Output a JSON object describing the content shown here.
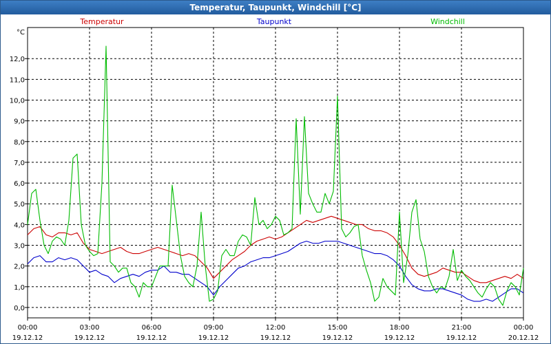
{
  "window": {
    "title": "Temperatur, Taupunkt, Windchill [°C]"
  },
  "chart_data": {
    "type": "line",
    "title": "Temperatur, Taupunkt, Windchill [°C]",
    "ylabel": "°C",
    "ylim": [
      -0.5,
      13.5
    ],
    "y_ticks": [
      0,
      1,
      2,
      3,
      4,
      5,
      6,
      7,
      8,
      9,
      10,
      11,
      12
    ],
    "y_tick_labels": [
      "0,0",
      "1,0",
      "2,0",
      "3,0",
      "4,0",
      "5,0",
      "6,0",
      "7,0",
      "8,0",
      "9,0",
      "10,0",
      "11,0",
      "12,0"
    ],
    "xlim": [
      0,
      24
    ],
    "x_ticks": [
      0,
      3,
      6,
      9,
      12,
      15,
      18,
      21,
      24
    ],
    "x_tick_labels": [
      [
        "00:00",
        "19.12.12"
      ],
      [
        "03:00",
        "19.12.12"
      ],
      [
        "06:00",
        "19.12.12"
      ],
      [
        "09:00",
        "19.12.12"
      ],
      [
        "12:00",
        "19.12.12"
      ],
      [
        "15:00",
        "19.12.12"
      ],
      [
        "18:00",
        "19.12.12"
      ],
      [
        "21:00",
        "19.12.12"
      ],
      [
        "00:00",
        "20.12.12"
      ]
    ],
    "grid": true,
    "legend_position": "top",
    "series": [
      {
        "name": "Temperatur",
        "color": "#cc0000",
        "x": [
          0,
          0.3,
          0.6,
          0.9,
          1.2,
          1.5,
          1.8,
          2.1,
          2.4,
          2.7,
          3.0,
          3.3,
          3.6,
          3.9,
          4.2,
          4.5,
          4.8,
          5.1,
          5.4,
          5.7,
          6.0,
          6.3,
          6.6,
          6.9,
          7.2,
          7.5,
          7.8,
          8.1,
          8.4,
          8.7,
          9.0,
          9.3,
          9.6,
          9.9,
          10.2,
          10.5,
          10.8,
          11.1,
          11.4,
          11.7,
          12.0,
          12.3,
          12.6,
          12.9,
          13.2,
          13.5,
          13.8,
          14.1,
          14.4,
          14.7,
          15.0,
          15.3,
          15.6,
          15.9,
          16.2,
          16.5,
          16.8,
          17.1,
          17.4,
          17.7,
          18.0,
          18.3,
          18.6,
          18.9,
          19.2,
          19.5,
          19.8,
          20.1,
          20.4,
          20.7,
          21.0,
          21.3,
          21.6,
          21.9,
          22.2,
          22.5,
          22.8,
          23.1,
          23.4,
          23.7,
          24.0
        ],
        "values": [
          3.5,
          3.8,
          3.9,
          3.5,
          3.4,
          3.6,
          3.6,
          3.5,
          3.6,
          3.1,
          2.8,
          2.7,
          2.6,
          2.7,
          2.8,
          2.9,
          2.7,
          2.6,
          2.6,
          2.7,
          2.8,
          2.9,
          2.8,
          2.7,
          2.6,
          2.5,
          2.6,
          2.5,
          2.2,
          1.9,
          1.4,
          1.7,
          2.0,
          2.3,
          2.5,
          2.7,
          3.0,
          3.2,
          3.3,
          3.4,
          3.3,
          3.4,
          3.6,
          3.8,
          4.0,
          4.2,
          4.1,
          4.2,
          4.3,
          4.4,
          4.3,
          4.2,
          4.1,
          4.0,
          4.0,
          3.8,
          3.7,
          3.7,
          3.6,
          3.4,
          3.0,
          2.5,
          1.9,
          1.6,
          1.5,
          1.6,
          1.7,
          1.9,
          1.8,
          1.7,
          1.7,
          1.5,
          1.3,
          1.2,
          1.2,
          1.3,
          1.4,
          1.5,
          1.4,
          1.6,
          1.4
        ]
      },
      {
        "name": "Taupunkt",
        "color": "#0000cc",
        "x": [
          0,
          0.3,
          0.6,
          0.9,
          1.2,
          1.5,
          1.8,
          2.1,
          2.4,
          2.7,
          3.0,
          3.3,
          3.6,
          3.9,
          4.2,
          4.5,
          4.8,
          5.1,
          5.4,
          5.7,
          6.0,
          6.3,
          6.6,
          6.9,
          7.2,
          7.5,
          7.8,
          8.1,
          8.4,
          8.7,
          9.0,
          9.3,
          9.6,
          9.9,
          10.2,
          10.5,
          10.8,
          11.1,
          11.4,
          11.7,
          12.0,
          12.3,
          12.6,
          12.9,
          13.2,
          13.5,
          13.8,
          14.1,
          14.4,
          14.7,
          15.0,
          15.3,
          15.6,
          15.9,
          16.2,
          16.5,
          16.8,
          17.1,
          17.4,
          17.7,
          18.0,
          18.3,
          18.6,
          18.9,
          19.2,
          19.5,
          19.8,
          20.1,
          20.4,
          20.7,
          21.0,
          21.3,
          21.6,
          21.9,
          22.2,
          22.5,
          22.8,
          23.1,
          23.4,
          23.7,
          24.0
        ],
        "values": [
          2.1,
          2.4,
          2.5,
          2.2,
          2.2,
          2.4,
          2.3,
          2.4,
          2.3,
          2.0,
          1.7,
          1.8,
          1.6,
          1.5,
          1.2,
          1.4,
          1.5,
          1.6,
          1.5,
          1.7,
          1.8,
          1.8,
          2.0,
          1.7,
          1.7,
          1.6,
          1.6,
          1.4,
          1.2,
          1.0,
          0.6,
          1.0,
          1.3,
          1.6,
          1.9,
          2.0,
          2.2,
          2.3,
          2.4,
          2.4,
          2.5,
          2.6,
          2.7,
          2.9,
          3.1,
          3.2,
          3.1,
          3.1,
          3.2,
          3.2,
          3.2,
          3.1,
          3.0,
          2.9,
          2.8,
          2.7,
          2.6,
          2.6,
          2.5,
          2.3,
          2.0,
          1.5,
          1.1,
          0.9,
          0.8,
          0.8,
          0.9,
          0.9,
          0.8,
          0.7,
          0.6,
          0.4,
          0.3,
          0.3,
          0.4,
          0.3,
          0.5,
          0.7,
          0.9,
          0.9,
          0.7
        ]
      },
      {
        "name": "Windchill",
        "color": "#00bb00",
        "x": [
          0,
          0.2,
          0.4,
          0.6,
          0.8,
          1.0,
          1.2,
          1.4,
          1.6,
          1.8,
          2.0,
          2.2,
          2.4,
          2.6,
          2.8,
          3.0,
          3.2,
          3.4,
          3.6,
          3.8,
          4.0,
          4.2,
          4.4,
          4.6,
          4.8,
          5.0,
          5.2,
          5.4,
          5.6,
          5.8,
          6.0,
          6.2,
          6.4,
          6.6,
          6.8,
          7.0,
          7.2,
          7.4,
          7.6,
          7.8,
          8.0,
          8.2,
          8.4,
          8.6,
          8.8,
          9.0,
          9.2,
          9.4,
          9.6,
          9.8,
          10.0,
          10.2,
          10.4,
          10.6,
          10.8,
          11.0,
          11.2,
          11.4,
          11.6,
          11.8,
          12.0,
          12.2,
          12.4,
          12.6,
          12.8,
          13.0,
          13.2,
          13.4,
          13.6,
          13.8,
          14.0,
          14.2,
          14.4,
          14.6,
          14.8,
          15.0,
          15.2,
          15.4,
          15.6,
          15.8,
          16.0,
          16.2,
          16.4,
          16.6,
          16.8,
          17.0,
          17.2,
          17.4,
          17.6,
          17.8,
          18.0,
          18.2,
          18.4,
          18.6,
          18.8,
          19.0,
          19.2,
          19.4,
          19.6,
          19.8,
          20.0,
          20.2,
          20.4,
          20.6,
          20.8,
          21.0,
          21.2,
          21.4,
          21.6,
          21.8,
          22.0,
          22.2,
          22.4,
          22.6,
          22.8,
          23.0,
          23.2,
          23.4,
          23.6,
          23.8,
          24.0
        ],
        "values": [
          4.0,
          5.5,
          5.7,
          4.2,
          3.0,
          2.6,
          3.2,
          3.4,
          3.3,
          3.0,
          4.2,
          7.2,
          7.4,
          4.0,
          3.0,
          2.7,
          2.5,
          2.6,
          6.0,
          12.6,
          2.2,
          2.0,
          1.7,
          1.9,
          1.9,
          1.2,
          1.0,
          0.5,
          1.2,
          1.0,
          1.0,
          1.5,
          2.0,
          2.0,
          2.0,
          5.9,
          4.2,
          2.5,
          1.5,
          1.2,
          1.0,
          2.0,
          4.6,
          2.0,
          0.3,
          0.4,
          0.8,
          2.5,
          2.8,
          2.5,
          2.5,
          3.2,
          3.5,
          3.4,
          3.0,
          5.3,
          4.0,
          4.2,
          3.8,
          4.0,
          4.4,
          4.2,
          3.5,
          3.6,
          3.8,
          9.1,
          4.5,
          9.2,
          5.5,
          5.0,
          4.6,
          4.6,
          5.5,
          5.0,
          5.6,
          10.2,
          3.8,
          3.4,
          3.6,
          3.9,
          4.0,
          2.5,
          1.8,
          1.2,
          0.3,
          0.5,
          1.4,
          1.0,
          0.8,
          0.6,
          4.6,
          1.2,
          2.5,
          4.6,
          5.2,
          3.3,
          2.7,
          1.5,
          1.0,
          0.7,
          1.0,
          0.9,
          1.5,
          2.8,
          1.3,
          1.8,
          1.5,
          1.3,
          1.0,
          0.7,
          0.5,
          0.9,
          1.2,
          1.0,
          0.4,
          0.1,
          0.8,
          1.2,
          1.0,
          0.6,
          1.9
        ]
      }
    ]
  }
}
